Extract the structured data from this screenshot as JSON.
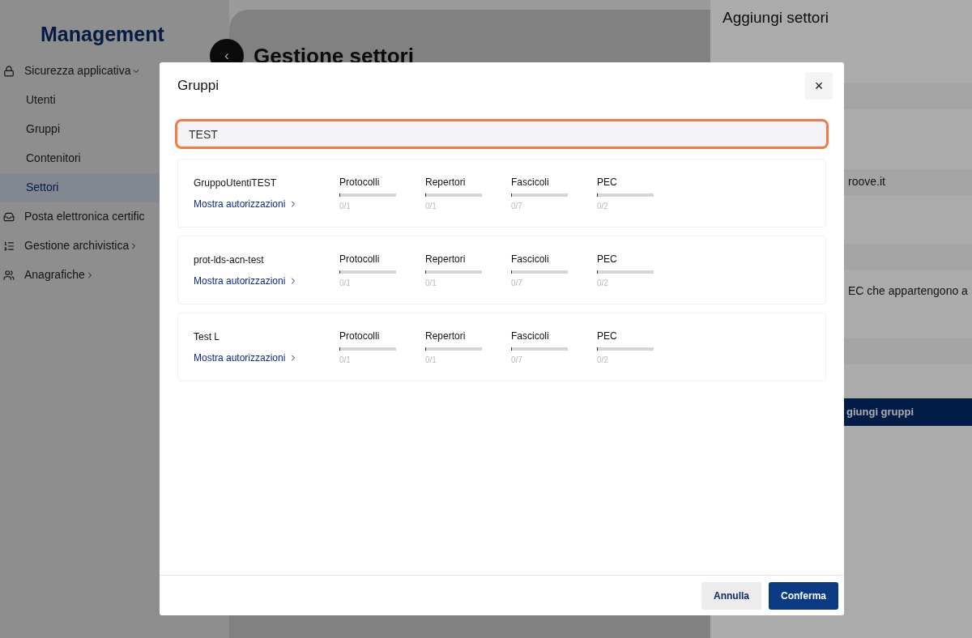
{
  "sidebar": {
    "title": "Management",
    "items": [
      {
        "label": "Sicurezza applicativa",
        "expanded": true,
        "selected": false,
        "children": [
          {
            "label": "Utenti",
            "selected": false
          },
          {
            "label": "Gruppi",
            "selected": false
          },
          {
            "label": "Contenitori",
            "selected": false
          },
          {
            "label": "Settori",
            "selected": true
          }
        ]
      },
      {
        "label": "Posta elettronica certific",
        "selected": false
      },
      {
        "label": "Gestione archivistica",
        "expanded": false,
        "selected": false
      },
      {
        "label": "Anagrafiche",
        "expanded": false,
        "selected": false
      }
    ]
  },
  "page": {
    "back": "‹",
    "title": "Gestione settori"
  },
  "side_panel": {
    "title": "Aggiungi settori",
    "fragments": [
      "roove.it",
      "EC che appartengono a"
    ],
    "button": "giungi gruppi"
  },
  "dialog": {
    "title": "Gruppi",
    "close": "×",
    "search": {
      "value": "TEST"
    },
    "groups": [
      {
        "name": "GruppoUtentiTEST",
        "link": "Mostra autorizzazioni",
        "stats": [
          {
            "label": "Protocolli",
            "level": 0,
            "reading": "0/1"
          },
          {
            "label": "Repertori",
            "level": 0,
            "reading": "0/1"
          },
          {
            "label": "Fascicoli",
            "level": 0,
            "reading": "0/7"
          },
          {
            "label": "PEC",
            "level": 0,
            "reading": "0/2"
          }
        ]
      },
      {
        "name": "prot-lds-acn-test",
        "link": "Mostra autorizzazioni",
        "stats": [
          {
            "label": "Protocolli",
            "level": 0,
            "reading": "0/1"
          },
          {
            "label": "Repertori",
            "level": 0,
            "reading": "0/1"
          },
          {
            "label": "Fascicoli",
            "level": 0,
            "reading": "0/7"
          },
          {
            "label": "PEC",
            "level": 0,
            "reading": "0/2"
          }
        ]
      },
      {
        "name": "Test L",
        "link": "Mostra autorizzazioni",
        "stats": [
          {
            "label": "Protocolli",
            "level": 0,
            "reading": "0/1"
          },
          {
            "label": "Repertori",
            "level": 0,
            "reading": "0/1"
          },
          {
            "label": "Fascicoli",
            "level": 0,
            "reading": "0/7"
          },
          {
            "label": "PEC",
            "level": 0,
            "reading": "0/2"
          }
        ]
      }
    ],
    "buttons": [
      {
        "label": "Annulla",
        "kind": "secondary"
      },
      {
        "label": "Conferma",
        "kind": "primary"
      }
    ]
  }
}
